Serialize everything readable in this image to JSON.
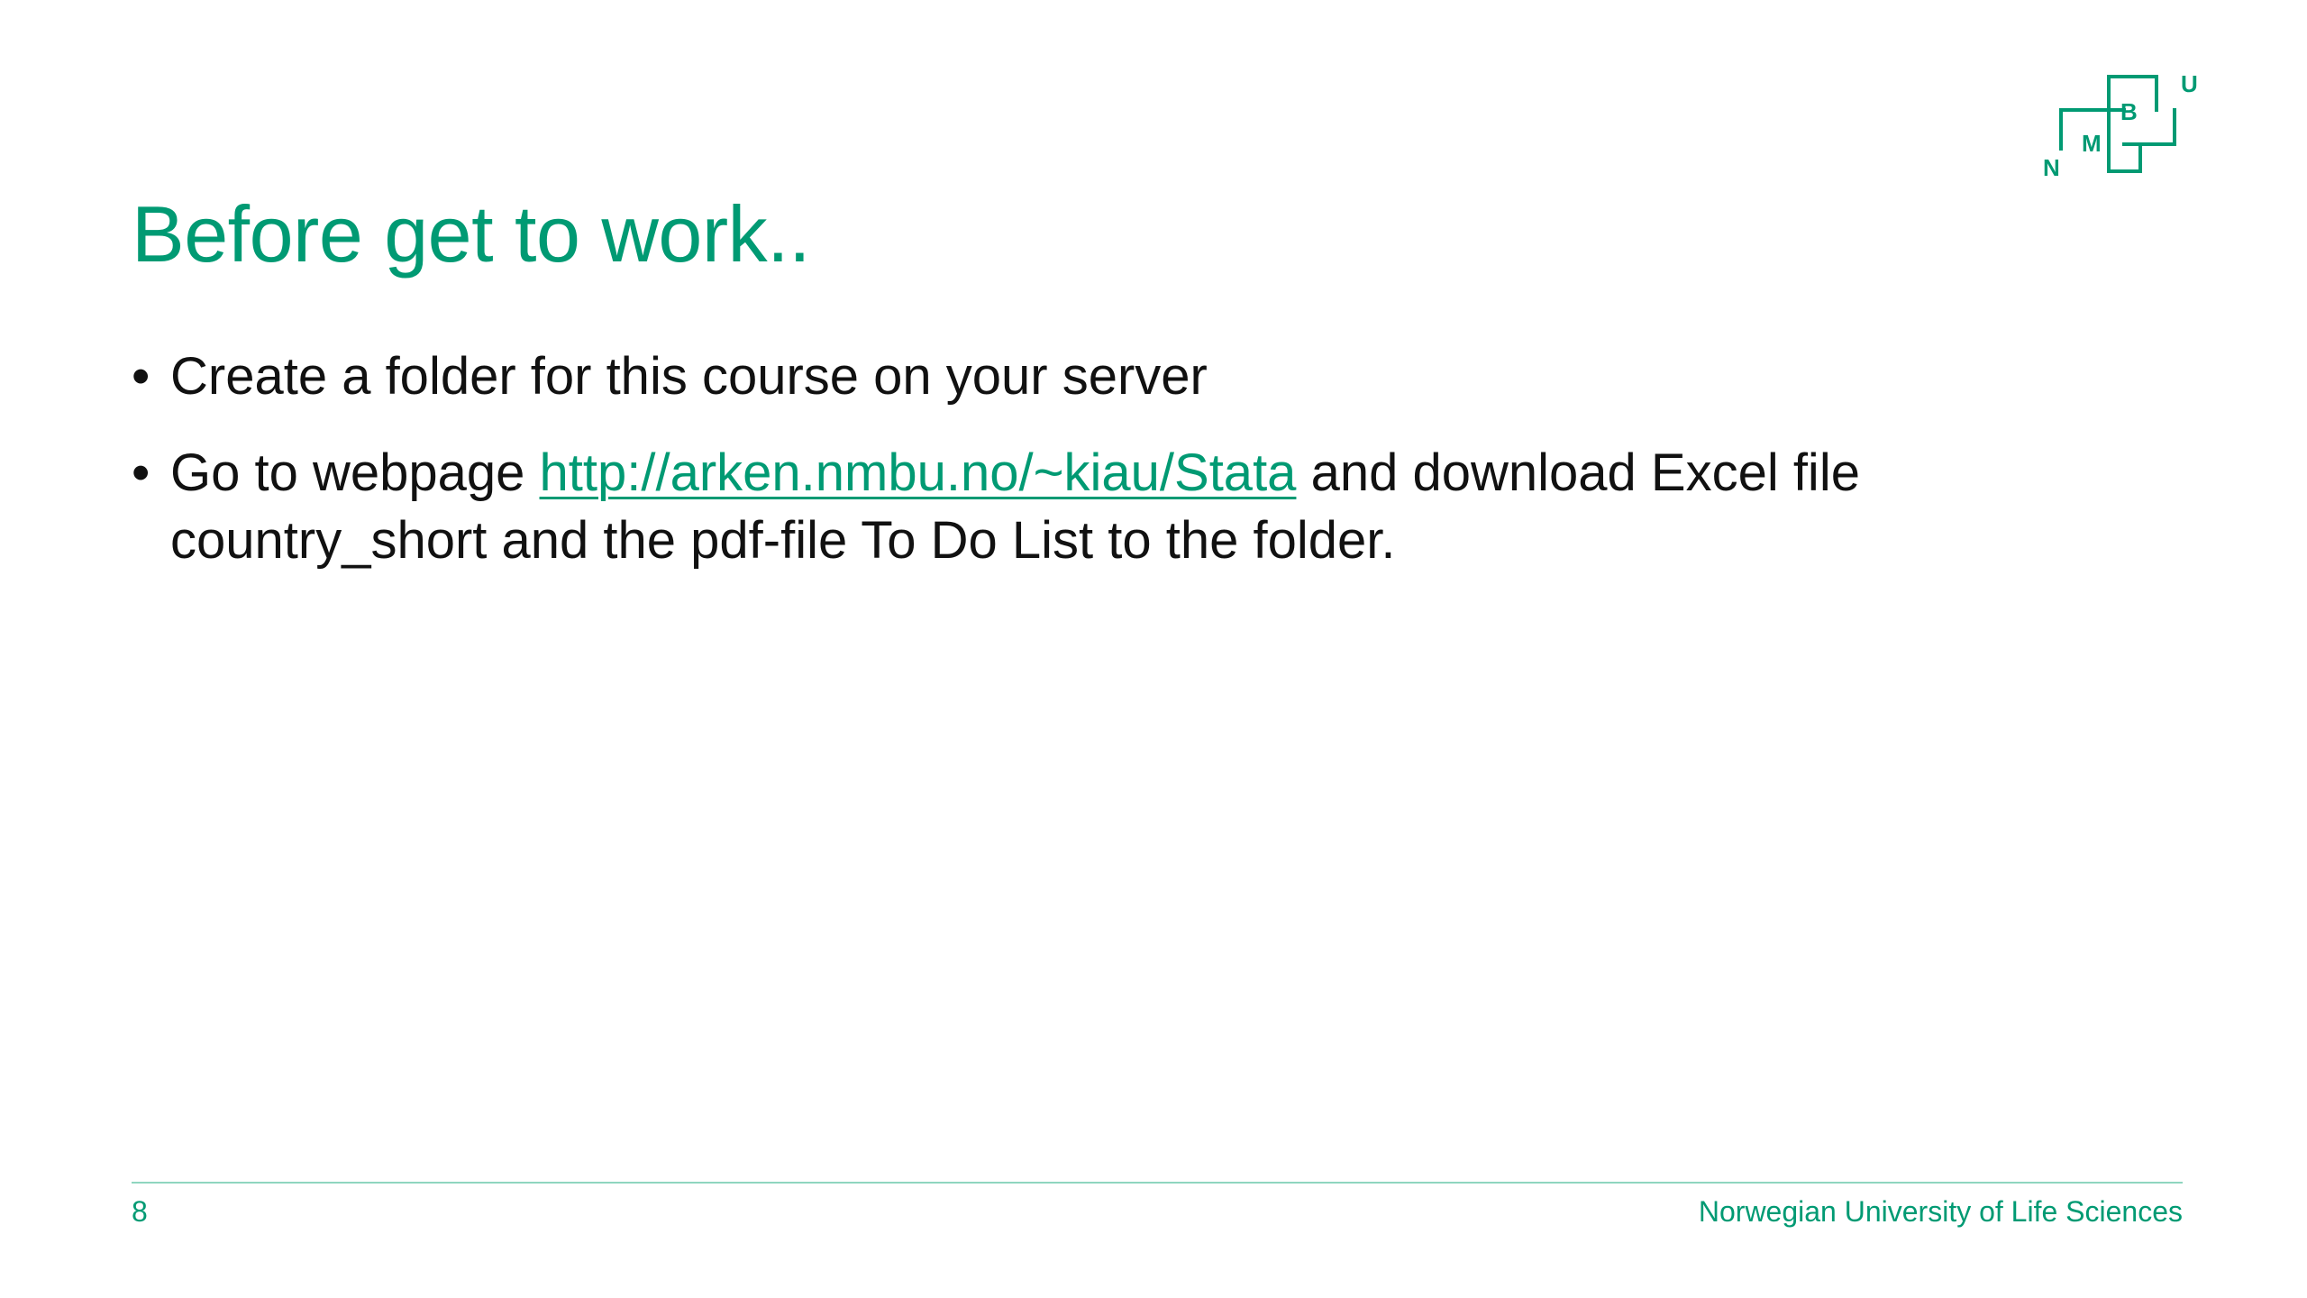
{
  "slide": {
    "title": "Before get to work..",
    "bullets": [
      {
        "text": "Create a folder for this course on your server"
      },
      {
        "before_link": "Go to webpage ",
        "link": "http://arken.nmbu.no/~kiau/Stata",
        "after_link": " and download Excel file country_short and the pdf-file To Do List to the folder."
      }
    ],
    "bullet_char": "•"
  },
  "logo": {
    "letters": [
      "N",
      "M",
      "B",
      "U"
    ],
    "icon": "nmbu-logo"
  },
  "footer": {
    "page_number": "8",
    "organization": "Norwegian University of Life Sciences"
  },
  "colors": {
    "accent": "#009A73",
    "text": "#111111",
    "background": "#ffffff"
  }
}
